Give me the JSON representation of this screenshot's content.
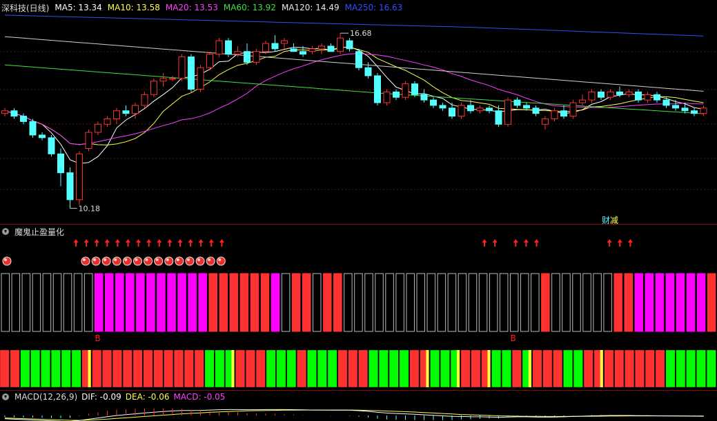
{
  "title": "深科技(日线)",
  "ma": {
    "ma5": {
      "label": "MA5: 13.34",
      "color": "#ffffff"
    },
    "ma10": {
      "label": "MA10: 13.58",
      "color": "#ffff4a"
    },
    "ma20": {
      "label": "MA20: 13.53",
      "color": "#ff40ff"
    },
    "ma60": {
      "label": "MA60: 13.92",
      "color": "#40e040"
    },
    "ma120": {
      "label": "MA120: 14.49",
      "color": "#e8e8e8"
    },
    "ma250": {
      "label": "MA250: 16.63",
      "color": "#3050ff"
    }
  },
  "price_annotations": {
    "high": "16.68",
    "low": "10.18"
  },
  "event_markers": {
    "cai": "财",
    "jian": "减"
  },
  "indicator": {
    "name": "魔鬼止盈量化",
    "buy_mark": "B"
  },
  "macd": {
    "label": "MACD(12,26,9)",
    "dif": "DIF: -0.09",
    "dea": "DEA: -0.06",
    "macd": "MACD: -0.05",
    "dif_color": "#ffffff",
    "dea_color": "#ffff4a",
    "macd_color": "#ff40ff"
  },
  "colors": {
    "up": "#ff3232",
    "down": "#54ffff",
    "magenta": "#ff00ff",
    "green": "#00ff00",
    "separator": "#7a1010"
  },
  "candles": [
    [
      13.7,
      13.9,
      13.6,
      13.8
    ],
    [
      13.8,
      13.9,
      13.5,
      13.6
    ],
    [
      13.6,
      13.7,
      13.3,
      13.4
    ],
    [
      13.4,
      13.5,
      12.8,
      12.9
    ],
    [
      12.9,
      13.0,
      12.7,
      12.8
    ],
    [
      12.8,
      12.9,
      12.1,
      12.2
    ],
    [
      12.2,
      12.4,
      11.0,
      11.5
    ],
    [
      11.5,
      11.7,
      10.18,
      10.5
    ],
    [
      10.5,
      12.3,
      10.3,
      12.2
    ],
    [
      12.4,
      13.1,
      12.3,
      13.0
    ],
    [
      13.0,
      13.4,
      12.9,
      13.3
    ],
    [
      13.3,
      13.6,
      13.2,
      13.5
    ],
    [
      13.5,
      13.9,
      13.3,
      13.8
    ],
    [
      13.8,
      14.0,
      13.6,
      13.7
    ],
    [
      13.7,
      14.1,
      13.5,
      14.0
    ],
    [
      14.0,
      14.5,
      13.9,
      14.4
    ],
    [
      14.4,
      15.0,
      14.3,
      14.9
    ],
    [
      14.9,
      15.2,
      14.7,
      15.0
    ],
    [
      15.0,
      15.1,
      14.9,
      15.0
    ],
    [
      15.0,
      15.9,
      14.9,
      15.8
    ],
    [
      15.8,
      15.9,
      14.5,
      14.6
    ],
    [
      14.6,
      15.5,
      14.5,
      15.4
    ],
    [
      15.4,
      16.0,
      15.3,
      15.9
    ],
    [
      15.9,
      16.5,
      15.8,
      16.4
    ],
    [
      16.4,
      16.5,
      15.8,
      15.9
    ],
    [
      15.9,
      16.2,
      15.8,
      16.0
    ],
    [
      16.0,
      16.3,
      15.5,
      15.6
    ],
    [
      15.6,
      16.1,
      15.5,
      16.0
    ],
    [
      16.0,
      16.4,
      15.9,
      16.3
    ],
    [
      16.3,
      16.6,
      16.0,
      16.1
    ],
    [
      16.3,
      16.5,
      16.1,
      16.4
    ],
    [
      16.1,
      16.3,
      16.0,
      16.0
    ],
    [
      16.0,
      16.2,
      15.8,
      15.9
    ],
    [
      16.0,
      16.2,
      15.9,
      16.1
    ],
    [
      16.1,
      16.3,
      15.9,
      16.2
    ],
    [
      16.2,
      16.3,
      16.0,
      16.0
    ],
    [
      16.0,
      16.68,
      15.9,
      16.5
    ],
    [
      16.4,
      16.5,
      16.0,
      16.1
    ],
    [
      16.0,
      16.1,
      15.3,
      15.4
    ],
    [
      15.4,
      15.6,
      15.0,
      15.1
    ],
    [
      15.1,
      15.2,
      14.0,
      14.1
    ],
    [
      14.1,
      14.6,
      14.0,
      14.5
    ],
    [
      14.5,
      14.6,
      14.2,
      14.3
    ],
    [
      14.3,
      14.9,
      14.2,
      14.8
    ],
    [
      14.8,
      14.9,
      14.3,
      14.4
    ],
    [
      14.4,
      14.6,
      14.1,
      14.2
    ],
    [
      14.2,
      14.3,
      13.9,
      14.0
    ],
    [
      14.0,
      14.1,
      13.8,
      13.9
    ],
    [
      13.9,
      14.1,
      13.5,
      13.6
    ],
    [
      13.6,
      14.1,
      13.5,
      14.0
    ],
    [
      14.0,
      14.2,
      13.7,
      13.8
    ],
    [
      13.8,
      14.0,
      13.7,
      13.9
    ],
    [
      13.9,
      14.0,
      13.7,
      13.8
    ],
    [
      13.8,
      14.0,
      13.2,
      13.3
    ],
    [
      13.3,
      14.3,
      13.2,
      14.2
    ],
    [
      14.2,
      14.3,
      13.9,
      14.0
    ],
    [
      14.0,
      14.1,
      13.8,
      13.9
    ],
    [
      13.9,
      14.0,
      13.6,
      13.7
    ],
    [
      13.3,
      13.6,
      13.1,
      13.5
    ],
    [
      13.5,
      13.9,
      13.4,
      13.8
    ],
    [
      13.8,
      14.0,
      13.5,
      13.6
    ],
    [
      13.6,
      14.2,
      13.5,
      14.1
    ],
    [
      14.1,
      14.4,
      14.0,
      14.2
    ],
    [
      14.2,
      14.6,
      14.1,
      14.5
    ],
    [
      14.5,
      14.6,
      14.2,
      14.3
    ],
    [
      14.3,
      14.6,
      14.2,
      14.5
    ],
    [
      14.5,
      14.7,
      14.3,
      14.4
    ],
    [
      14.4,
      14.6,
      14.3,
      14.5
    ],
    [
      14.5,
      14.6,
      14.1,
      14.2
    ],
    [
      14.2,
      14.5,
      14.1,
      14.4
    ],
    [
      14.4,
      14.5,
      14.1,
      14.2
    ],
    [
      14.2,
      14.3,
      13.9,
      14.0
    ],
    [
      14.0,
      14.2,
      13.8,
      13.9
    ],
    [
      13.9,
      14.1,
      13.7,
      13.8
    ],
    [
      13.8,
      13.9,
      13.6,
      13.7
    ],
    [
      13.7,
      14.0,
      13.6,
      13.9
    ]
  ],
  "ind_up_arrows": [
    7,
    8,
    9,
    10,
    11,
    12,
    13,
    14,
    15,
    16,
    17,
    18,
    19,
    20,
    21,
    46,
    47,
    49,
    50,
    51,
    58,
    59,
    60
  ],
  "ind_balls": [
    0,
    8,
    9,
    10,
    11,
    12,
    13,
    14,
    15,
    16,
    17,
    18,
    19,
    20,
    21
  ],
  "ind_bars": "eeeeeeeeemmmmmmmmmmmrrrrrrmerrerreeeeeeeeeeeeeeeeeeereeeeeerrmmmmmmmrer eeeeee",
  "ind_b_marks": [
    9,
    49
  ],
  "bottom_bars": "rrggggggrYrrrrrrrrrrrgggYrrrgggrgggrrrggggrrYgggYrrrYggrgYrrrggrrYrrrrrrggggggggg",
  "dif_line": [
    -0.4,
    -0.45,
    -0.5,
    -0.55,
    -0.6,
    -0.65,
    -0.7,
    -0.72,
    -0.6,
    -0.45,
    -0.3,
    -0.15,
    0,
    0.1,
    0.2,
    0.3,
    0.4,
    0.48,
    0.55,
    0.6,
    0.6,
    0.62,
    0.66,
    0.7,
    0.72,
    0.72,
    0.7,
    0.7,
    0.72,
    0.72,
    0.72,
    0.7,
    0.68,
    0.66,
    0.66,
    0.65,
    0.66,
    0.64,
    0.58,
    0.5,
    0.38,
    0.3,
    0.24,
    0.2,
    0.14,
    0.08,
    0.02,
    -0.04,
    -0.1,
    -0.12,
    -0.15,
    -0.16,
    -0.18,
    -0.22,
    -0.18,
    -0.16,
    -0.16,
    -0.18,
    -0.2,
    -0.18,
    -0.16,
    -0.12,
    -0.08,
    -0.04,
    -0.02,
    0,
    0.0,
    0.0,
    -0.02,
    -0.02,
    -0.04,
    -0.05,
    -0.06,
    -0.07,
    -0.08,
    -0.09
  ],
  "dea_line": [
    -0.3,
    -0.34,
    -0.38,
    -0.42,
    -0.46,
    -0.5,
    -0.54,
    -0.58,
    -0.58,
    -0.56,
    -0.5,
    -0.44,
    -0.36,
    -0.28,
    -0.2,
    -0.12,
    -0.04,
    0.04,
    0.12,
    0.2,
    0.26,
    0.32,
    0.38,
    0.44,
    0.48,
    0.52,
    0.56,
    0.58,
    0.6,
    0.62,
    0.64,
    0.65,
    0.66,
    0.66,
    0.66,
    0.66,
    0.66,
    0.66,
    0.64,
    0.62,
    0.58,
    0.54,
    0.5,
    0.46,
    0.42,
    0.36,
    0.3,
    0.24,
    0.18,
    0.12,
    0.08,
    0.04,
    0.0,
    -0.04,
    -0.06,
    -0.08,
    -0.1,
    -0.11,
    -0.12,
    -0.12,
    -0.12,
    -0.11,
    -0.1,
    -0.09,
    -0.08,
    -0.07,
    -0.06,
    -0.05,
    -0.05,
    -0.05,
    -0.05,
    -0.05,
    -0.05,
    -0.06,
    -0.06,
    -0.06
  ]
}
